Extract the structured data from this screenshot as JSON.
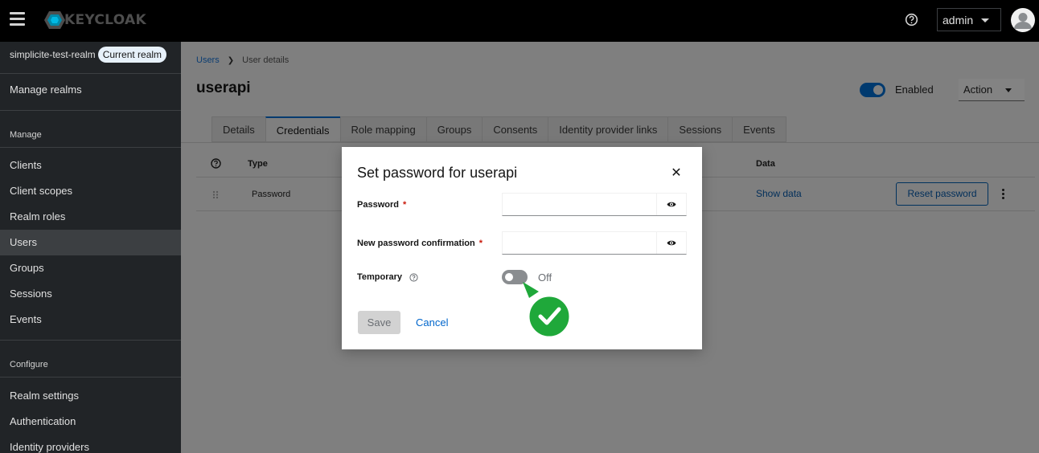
{
  "masthead": {
    "logo_text": "KEYCLOAK",
    "user": "admin"
  },
  "sidebar": {
    "realm_name": "simplicite-test-realm",
    "realm_badge": "Current realm",
    "manage_realms": "Manage realms",
    "manage_section": "Manage",
    "manage_items": [
      "Clients",
      "Client scopes",
      "Realm roles",
      "Users",
      "Groups",
      "Sessions",
      "Events"
    ],
    "active_item": "Users",
    "configure_section": "Configure",
    "configure_items": [
      "Realm settings",
      "Authentication",
      "Identity providers"
    ]
  },
  "main": {
    "breadcrumb": {
      "link": "Users",
      "current": "User details"
    },
    "title": "userapi",
    "enabled_label": "Enabled",
    "action_label": "Action",
    "tabs": [
      "Details",
      "Credentials",
      "Role mapping",
      "Groups",
      "Consents",
      "Identity provider links",
      "Sessions",
      "Events"
    ],
    "active_tab": "Credentials",
    "table": {
      "col_type": "Type",
      "col_data": "Data",
      "row_type": "Password",
      "show_data": "Show data",
      "reset_password": "Reset password"
    }
  },
  "modal": {
    "title": "Set password for userapi",
    "password_label": "Password",
    "confirm_label": "New password confirmation",
    "required_mark": "*",
    "temporary_label": "Temporary",
    "temporary_state": "Off",
    "save_label": "Save",
    "cancel_label": "Cancel"
  },
  "colors": {
    "masthead_bg": "#000000",
    "sidebar_bg": "#212427",
    "accent": "#0066cc",
    "annotation_green": "#1fa83a"
  }
}
